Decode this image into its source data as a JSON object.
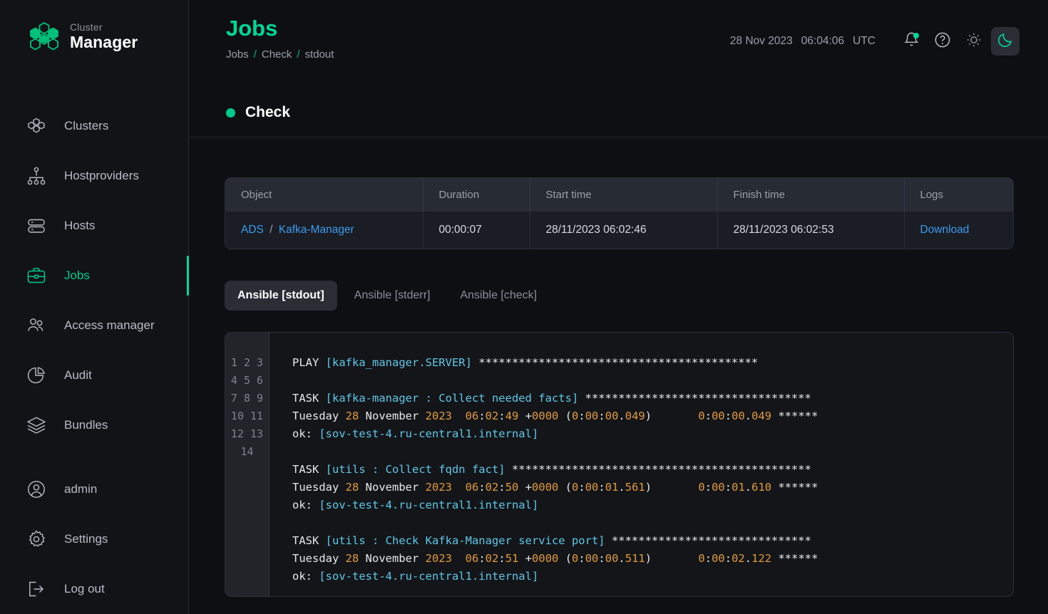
{
  "brand": {
    "top": "Cluster",
    "bottom": "Manager",
    "icon": "hexagon-cluster-logo"
  },
  "sidebar": {
    "items": [
      {
        "label": "Clusters",
        "icon": "clusters-icon",
        "active": false
      },
      {
        "label": "Hostproviders",
        "icon": "hostproviders-icon",
        "active": false
      },
      {
        "label": "Hosts",
        "icon": "hosts-icon",
        "active": false
      },
      {
        "label": "Jobs",
        "icon": "jobs-icon",
        "active": true
      },
      {
        "label": "Access manager",
        "icon": "access-manager-icon",
        "active": false
      },
      {
        "label": "Audit",
        "icon": "audit-icon",
        "active": false
      },
      {
        "label": "Bundles",
        "icon": "bundles-icon",
        "active": false
      }
    ],
    "footer_items": [
      {
        "label": "admin",
        "icon": "user-circle-icon"
      },
      {
        "label": "Settings",
        "icon": "gear-icon"
      },
      {
        "label": "Log out",
        "icon": "logout-icon"
      }
    ]
  },
  "header": {
    "title": "Jobs",
    "breadcrumb": [
      {
        "label": "Jobs",
        "last": false
      },
      {
        "label": "Check",
        "last": false
      },
      {
        "label": "stdout",
        "last": true
      }
    ],
    "separator": "/",
    "date": "28 Nov 2023",
    "time": "06:04:06",
    "timezone": "UTC",
    "icons": {
      "bell": "bell-icon",
      "help": "question-circle-icon",
      "light": "sun-icon",
      "dark": "moon-icon"
    }
  },
  "section": {
    "title": "Check",
    "status_color": "#00c98d"
  },
  "table": {
    "columns": [
      "Object",
      "Duration",
      "Start time",
      "Finish time",
      "Logs"
    ],
    "row": {
      "object_primary": "ADS",
      "object_separator": "/",
      "object_secondary": "Kafka-Manager",
      "duration": "00:00:07",
      "start_time": "28/11/2023 06:02:46",
      "finish_time": "28/11/2023 06:02:53",
      "logs": "Download"
    }
  },
  "tabs": [
    {
      "label": "Ansible [stdout]",
      "active": true
    },
    {
      "label": "Ansible [stderr]",
      "active": false
    },
    {
      "label": "Ansible [check]",
      "active": false
    }
  ],
  "terminal": {
    "line_numbers": "1\n2\n3\n4\n5\n6\n7\n8\n9\n10\n11\n12\n13\n14",
    "lines": [
      {
        "n": 1,
        "segments": [
          {
            "t": "PLAY ",
            "c": "wh"
          },
          {
            "t": "[kafka_manager.SERVER]",
            "c": "cy"
          },
          {
            "t": " ******************************************",
            "c": "wh"
          }
        ]
      },
      {
        "n": 2,
        "segments": []
      },
      {
        "n": 3,
        "segments": [
          {
            "t": "TASK ",
            "c": "wh"
          },
          {
            "t": "[kafka-manager : Collect needed facts]",
            "c": "cy"
          },
          {
            "t": " **********************************",
            "c": "wh"
          }
        ]
      },
      {
        "n": 4,
        "segments": [
          {
            "t": "Tuesday ",
            "c": "wh"
          },
          {
            "t": "28",
            "c": "or"
          },
          {
            "t": " November ",
            "c": "wh"
          },
          {
            "t": "2023",
            "c": "or"
          },
          {
            "t": "  ",
            "c": "wh"
          },
          {
            "t": "06",
            "c": "or"
          },
          {
            "t": ":",
            "c": "wh"
          },
          {
            "t": "02",
            "c": "or"
          },
          {
            "t": ":",
            "c": "wh"
          },
          {
            "t": "49",
            "c": "or"
          },
          {
            "t": " +",
            "c": "wh"
          },
          {
            "t": "0000",
            "c": "or"
          },
          {
            "t": " (",
            "c": "wh"
          },
          {
            "t": "0",
            "c": "or"
          },
          {
            "t": ":",
            "c": "wh"
          },
          {
            "t": "00",
            "c": "or"
          },
          {
            "t": ":",
            "c": "wh"
          },
          {
            "t": "00",
            "c": "or"
          },
          {
            "t": ".",
            "c": "wh"
          },
          {
            "t": "049",
            "c": "or"
          },
          {
            "t": ")       ",
            "c": "wh"
          },
          {
            "t": "0",
            "c": "or"
          },
          {
            "t": ":",
            "c": "wh"
          },
          {
            "t": "00",
            "c": "or"
          },
          {
            "t": ":",
            "c": "wh"
          },
          {
            "t": "00",
            "c": "or"
          },
          {
            "t": ".",
            "c": "wh"
          },
          {
            "t": "049",
            "c": "or"
          },
          {
            "t": " ******",
            "c": "wh"
          }
        ]
      },
      {
        "n": 5,
        "segments": [
          {
            "t": "ok: ",
            "c": "wh"
          },
          {
            "t": "[sov-test-4.ru-central1.internal]",
            "c": "cy"
          }
        ]
      },
      {
        "n": 6,
        "segments": []
      },
      {
        "n": 7,
        "segments": [
          {
            "t": "TASK ",
            "c": "wh"
          },
          {
            "t": "[utils : Collect fqdn fact]",
            "c": "cy"
          },
          {
            "t": " *********************************************",
            "c": "wh"
          }
        ]
      },
      {
        "n": 8,
        "segments": [
          {
            "t": "Tuesday ",
            "c": "wh"
          },
          {
            "t": "28",
            "c": "or"
          },
          {
            "t": " November ",
            "c": "wh"
          },
          {
            "t": "2023",
            "c": "or"
          },
          {
            "t": "  ",
            "c": "wh"
          },
          {
            "t": "06",
            "c": "or"
          },
          {
            "t": ":",
            "c": "wh"
          },
          {
            "t": "02",
            "c": "or"
          },
          {
            "t": ":",
            "c": "wh"
          },
          {
            "t": "50",
            "c": "or"
          },
          {
            "t": " +",
            "c": "wh"
          },
          {
            "t": "0000",
            "c": "or"
          },
          {
            "t": " (",
            "c": "wh"
          },
          {
            "t": "0",
            "c": "or"
          },
          {
            "t": ":",
            "c": "wh"
          },
          {
            "t": "00",
            "c": "or"
          },
          {
            "t": ":",
            "c": "wh"
          },
          {
            "t": "01",
            "c": "or"
          },
          {
            "t": ".",
            "c": "wh"
          },
          {
            "t": "561",
            "c": "or"
          },
          {
            "t": ")       ",
            "c": "wh"
          },
          {
            "t": "0",
            "c": "or"
          },
          {
            "t": ":",
            "c": "wh"
          },
          {
            "t": "00",
            "c": "or"
          },
          {
            "t": ":",
            "c": "wh"
          },
          {
            "t": "01",
            "c": "or"
          },
          {
            "t": ".",
            "c": "wh"
          },
          {
            "t": "610",
            "c": "or"
          },
          {
            "t": " ******",
            "c": "wh"
          }
        ]
      },
      {
        "n": 9,
        "segments": [
          {
            "t": "ok: ",
            "c": "wh"
          },
          {
            "t": "[sov-test-4.ru-central1.internal]",
            "c": "cy"
          }
        ]
      },
      {
        "n": 10,
        "segments": []
      },
      {
        "n": 11,
        "segments": [
          {
            "t": "TASK ",
            "c": "wh"
          },
          {
            "t": "[utils : Check Kafka-Manager service port]",
            "c": "cy"
          },
          {
            "t": " ******************************",
            "c": "wh"
          }
        ]
      },
      {
        "n": 12,
        "segments": [
          {
            "t": "Tuesday ",
            "c": "wh"
          },
          {
            "t": "28",
            "c": "or"
          },
          {
            "t": " November ",
            "c": "wh"
          },
          {
            "t": "2023",
            "c": "or"
          },
          {
            "t": "  ",
            "c": "wh"
          },
          {
            "t": "06",
            "c": "or"
          },
          {
            "t": ":",
            "c": "wh"
          },
          {
            "t": "02",
            "c": "or"
          },
          {
            "t": ":",
            "c": "wh"
          },
          {
            "t": "51",
            "c": "or"
          },
          {
            "t": " +",
            "c": "wh"
          },
          {
            "t": "0000",
            "c": "or"
          },
          {
            "t": " (",
            "c": "wh"
          },
          {
            "t": "0",
            "c": "or"
          },
          {
            "t": ":",
            "c": "wh"
          },
          {
            "t": "00",
            "c": "or"
          },
          {
            "t": ":",
            "c": "wh"
          },
          {
            "t": "00",
            "c": "or"
          },
          {
            "t": ".",
            "c": "wh"
          },
          {
            "t": "511",
            "c": "or"
          },
          {
            "t": ")       ",
            "c": "wh"
          },
          {
            "t": "0",
            "c": "or"
          },
          {
            "t": ":",
            "c": "wh"
          },
          {
            "t": "00",
            "c": "or"
          },
          {
            "t": ":",
            "c": "wh"
          },
          {
            "t": "02",
            "c": "or"
          },
          {
            "t": ".",
            "c": "wh"
          },
          {
            "t": "122",
            "c": "or"
          },
          {
            "t": " ******",
            "c": "wh"
          }
        ]
      },
      {
        "n": 13,
        "segments": [
          {
            "t": "ok: ",
            "c": "wh"
          },
          {
            "t": "[sov-test-4.ru-central1.internal]",
            "c": "cy"
          }
        ]
      },
      {
        "n": 14,
        "segments": []
      }
    ]
  },
  "colors": {
    "accent_green": "#00d897",
    "link_blue": "#3a9bf0",
    "terminal_cyan": "#5fc8e8",
    "terminal_orange": "#e09a3e",
    "bg": "#0e0f12"
  }
}
